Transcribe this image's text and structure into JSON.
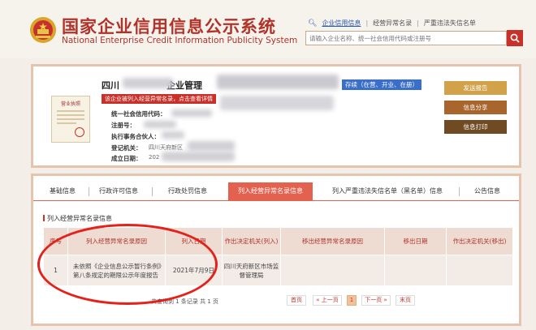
{
  "header": {
    "title_cn": "国家企业信用信息公示系统",
    "title_en": "National Enterprise Credit Information Publicity System",
    "links": [
      "企业信用信息",
      "经营异常名录",
      "严重违法失信名单"
    ],
    "search_placeholder": "请输入企业名称、统一社会信用代码或注册号"
  },
  "company": {
    "name_prefix": "四川",
    "name_suffix": "企业管理",
    "status": "存续（在营、开业、在册）",
    "abnormal_notice": "该企业被列入经营异常名录，点击查看详情",
    "license_label": "营业执照",
    "fields": [
      {
        "label": "统一社会信用代码：",
        "value": ""
      },
      {
        "label": "注册号：",
        "value": ""
      },
      {
        "label": "执行事务合伙人：",
        "value": ""
      },
      {
        "label": "登记机关：",
        "value": "四川天府新区"
      },
      {
        "label": "成立日期：",
        "value": "202"
      }
    ],
    "actions": [
      "发送报告",
      "信息分享",
      "信息打印"
    ]
  },
  "tabs": [
    "基础信息",
    "行政许可信息",
    "行政处罚信息",
    "列入经营异常名录信息",
    "列入严重违法失信名单（黑名单）信息",
    "公告信息"
  ],
  "section_title": "列入经营异常名录信息",
  "table": {
    "headers": [
      "序号",
      "列入经营异常名录原因",
      "列入日期",
      "作出决定机关(列入)",
      "移出经营异常名录原因",
      "移出日期",
      "作出决定机关(移出)"
    ],
    "rows": [
      [
        "1",
        "未依照《企业信息公示暂行条例》第八条规定的期限公示年度报告",
        "2021年7月9日",
        "四川天府新区市场监督管理局",
        "",
        "",
        ""
      ]
    ]
  },
  "pager": {
    "info": "共查询到 1 条记录 共 1 页",
    "first": "首页",
    "prev": "« 上一页",
    "current": "1",
    "next": "下一页 »",
    "last": "末页"
  },
  "colors": {
    "brand_red": "#c8312a",
    "accent_blue": "#3a6fc9",
    "tab_active": "#e2614f"
  }
}
